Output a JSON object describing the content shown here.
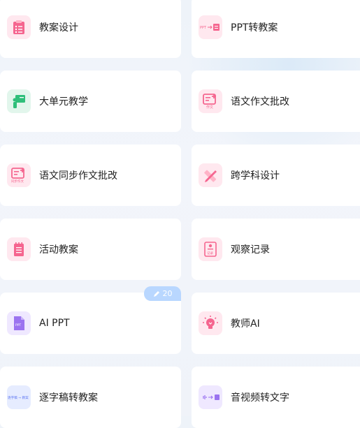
{
  "items": [
    {
      "label": "教案设计",
      "icon": "clipboard-list-icon"
    },
    {
      "label": "PPT转教案",
      "icon": "ppt-convert-icon"
    },
    {
      "label": "大单元教学",
      "icon": "teacher-board-icon"
    },
    {
      "label": "语文作文批改",
      "icon": "essay-grading-icon"
    },
    {
      "label": "语文同步作文批改",
      "icon": "sync-essay-icon"
    },
    {
      "label": "跨学科设计",
      "icon": "ruler-pencil-icon"
    },
    {
      "label": "活动教案",
      "icon": "notepad-icon"
    },
    {
      "label": "观察记录",
      "icon": "observation-record-icon"
    },
    {
      "label": "AI PPT",
      "icon": "ppt-file-icon"
    },
    {
      "label": "教师AI",
      "icon": "lightbulb-icon"
    },
    {
      "label": "逐字稿转教案",
      "icon": "transcript-convert-icon"
    },
    {
      "label": "音视频转文字",
      "icon": "audio-to-text-icon"
    }
  ],
  "icon_text": {
    "ppt_small": "PPT",
    "essay_small": "作文",
    "sync_small": "同步作文",
    "record_small": "记录",
    "ppt_file_small": "PPT",
    "transcript_small": "逐字稿 → 教案"
  },
  "badge": {
    "count": "20",
    "icon": "pencil-icon"
  },
  "colors": {
    "accent_pink": "#f5658f",
    "accent_green": "#2fbf7a",
    "accent_purple": "#9b73f0",
    "accent_blue": "#5b73f2",
    "badge_bg": "#b9d7ff"
  }
}
